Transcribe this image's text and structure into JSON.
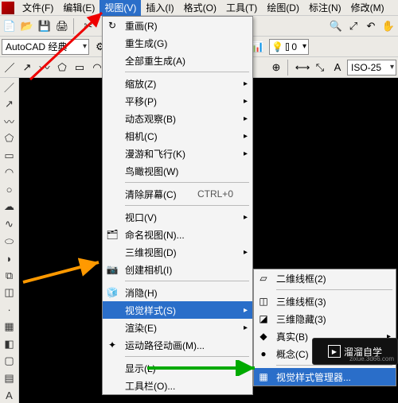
{
  "menubar": {
    "items": [
      "文件(F)",
      "编辑(E)",
      "视图(V)",
      "插入(I)",
      "格式(O)",
      "工具(T)",
      "绘图(D)",
      "标注(N)",
      "修改(M)"
    ],
    "active_index": 2
  },
  "workspace": {
    "label": "AutoCAD 经典"
  },
  "layer": {
    "name": "0"
  },
  "dimstyle": {
    "name": "ISO-25"
  },
  "view_menu": {
    "items": [
      {
        "label": "重画(R)",
        "icon": "↻"
      },
      {
        "label": "重生成(G)"
      },
      {
        "label": "全部重生成(A)"
      },
      {
        "sep": true
      },
      {
        "label": "缩放(Z)",
        "sub": true
      },
      {
        "label": "平移(P)",
        "sub": true
      },
      {
        "label": "动态观察(B)",
        "sub": true
      },
      {
        "label": "相机(C)",
        "sub": true
      },
      {
        "label": "漫游和飞行(K)",
        "sub": true
      },
      {
        "label": "鸟瞰视图(W)"
      },
      {
        "sep": true
      },
      {
        "label": "清除屏幕(C)",
        "shortcut": "CTRL+0"
      },
      {
        "sep": true
      },
      {
        "label": "视口(V)",
        "sub": true
      },
      {
        "label": "命名视图(N)...",
        "icon": "🗂"
      },
      {
        "label": "三维视图(D)",
        "sub": true
      },
      {
        "label": "创建相机(I)",
        "icon": "📷"
      },
      {
        "sep": true
      },
      {
        "label": "消隐(H)",
        "icon": "🧊"
      },
      {
        "label": "视觉样式(S)",
        "sub": true,
        "sel": true
      },
      {
        "label": "渲染(E)",
        "sub": true
      },
      {
        "label": "运动路径动画(M)...",
        "icon": "✦"
      },
      {
        "sep": true
      },
      {
        "label": "显示(L)",
        "sub": true
      },
      {
        "label": "工具栏(O)..."
      }
    ]
  },
  "sub_menu": {
    "items": [
      {
        "label": "二维线框(2)",
        "icon": "▱"
      },
      {
        "sep": true
      },
      {
        "label": "三维线框(3)",
        "icon": "◫"
      },
      {
        "label": "三维隐藏(3)",
        "icon": "◪"
      },
      {
        "label": "真实(B)",
        "icon": "◆",
        "sub": true
      },
      {
        "label": "概念(C)",
        "icon": "●",
        "sub": true
      },
      {
        "sep": true
      },
      {
        "label": "视觉样式管理器...",
        "icon": "▦",
        "sel": true
      }
    ]
  },
  "watermark": {
    "text": "溜溜自学",
    "url": "zixue.3d66.com"
  }
}
